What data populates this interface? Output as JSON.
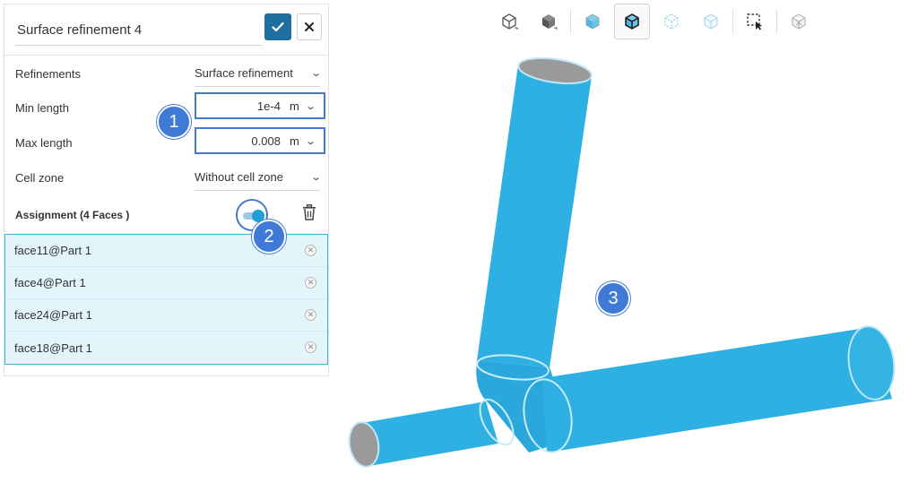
{
  "panel": {
    "title": "Surface refinement 4",
    "confirm_icon": "check-icon",
    "close_icon": "close-icon",
    "refinements_label": "Refinements",
    "refinements_value": "Surface refinement",
    "min_length_label": "Min length",
    "min_length_value": "1e-4",
    "min_length_unit": "m",
    "max_length_label": "Max length",
    "max_length_value": "0.008",
    "max_length_unit": "m",
    "cell_zone_label": "Cell zone",
    "cell_zone_value": "Without cell zone",
    "assignment_label": "Assignment (4 Faces )",
    "faces": [
      "face11@Part 1",
      "face4@Part 1",
      "face24@Part 1",
      "face18@Part 1"
    ]
  },
  "markers": [
    "1",
    "2",
    "3"
  ],
  "toolbar": {
    "buttons": [
      "iso-view-icon",
      "shaded-view-icon",
      "transparent-view-icon",
      "edges-view-icon",
      "wireframe-view-icon",
      "ghost-view-icon",
      "box-select-icon",
      "hide-icon"
    ]
  },
  "colors": {
    "accent": "#1d6f9f",
    "selection_fill": "#e2f5fb",
    "selection_border": "#3fb2e0",
    "marker": "#3f7ad6",
    "pipe": "#2fb0e2"
  }
}
